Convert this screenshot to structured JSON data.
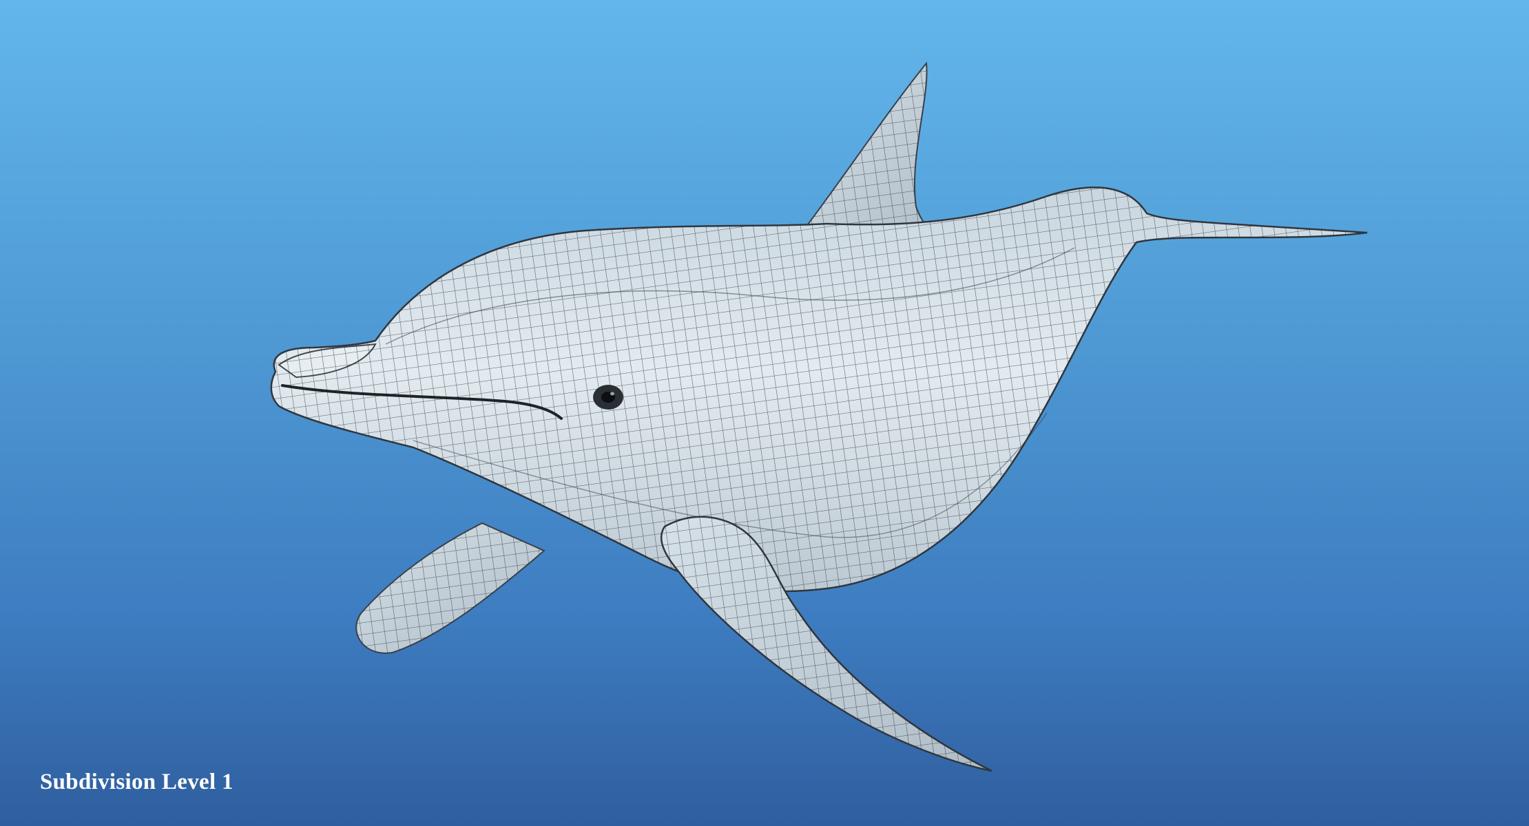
{
  "caption": {
    "text": "Subdivision Level 1"
  },
  "colors": {
    "background_top": "#62b6ea",
    "background_bottom": "#2f5e9e",
    "model_surface": "#dde7ee",
    "wireframe": "#2a2f36",
    "caption_text": "#ffffff"
  },
  "model": {
    "subject": "dolphin-icon"
  }
}
